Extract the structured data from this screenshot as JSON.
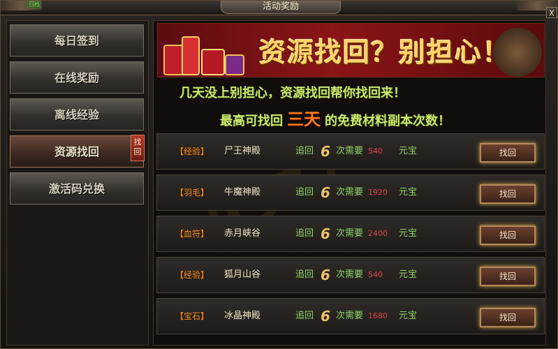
{
  "window": {
    "title": "活动奖励",
    "corner_tag": "回档",
    "close_label": "X"
  },
  "sidebar": {
    "items": [
      {
        "label": "每日签到"
      },
      {
        "label": "在线奖励"
      },
      {
        "label": "离线经验"
      },
      {
        "label": "资源找回",
        "active": true
      },
      {
        "label": "激活码兑换"
      }
    ],
    "active_badge": "找回"
  },
  "banner": {
    "title": "资源找回？别担心！"
  },
  "subtitle": {
    "line1": "几天没上别担心，资源找回帮你找回来！",
    "line2_prefix": "最高可找回",
    "line2_highlight": "三天",
    "line2_suffix": "的免费材料副本次数！"
  },
  "rows": [
    {
      "category": "【经验】",
      "dungeon": "尸王神殿",
      "retrieve": "追回",
      "count": "6",
      "need": "次需要",
      "cost": "540",
      "currency": "元宝",
      "button": "找回"
    },
    {
      "category": "【羽毛】",
      "dungeon": "牛魔神殿",
      "retrieve": "追回",
      "count": "6",
      "need": "次需要",
      "cost": "1920",
      "currency": "元宝",
      "button": "找回"
    },
    {
      "category": "【血符】",
      "dungeon": "赤月峡谷",
      "retrieve": "追回",
      "count": "6",
      "need": "次需要",
      "cost": "2400",
      "currency": "元宝",
      "button": "找回"
    },
    {
      "category": "【经验】",
      "dungeon": "狐月山谷",
      "retrieve": "追回",
      "count": "6",
      "need": "次需要",
      "cost": "540",
      "currency": "元宝",
      "button": "找回"
    },
    {
      "category": "【宝石】",
      "dungeon": "冰晶神殿",
      "retrieve": "追回",
      "count": "6",
      "need": "次需要",
      "cost": "1680",
      "currency": "元宝",
      "button": "找回"
    }
  ],
  "watermark": "9377",
  "colors": {
    "accent_gold": "#ffd36a",
    "green_text": "#8fd66a",
    "orange_category": "#ff8c1a",
    "red_cost": "#e04848",
    "banner_red": "#8b1517"
  }
}
